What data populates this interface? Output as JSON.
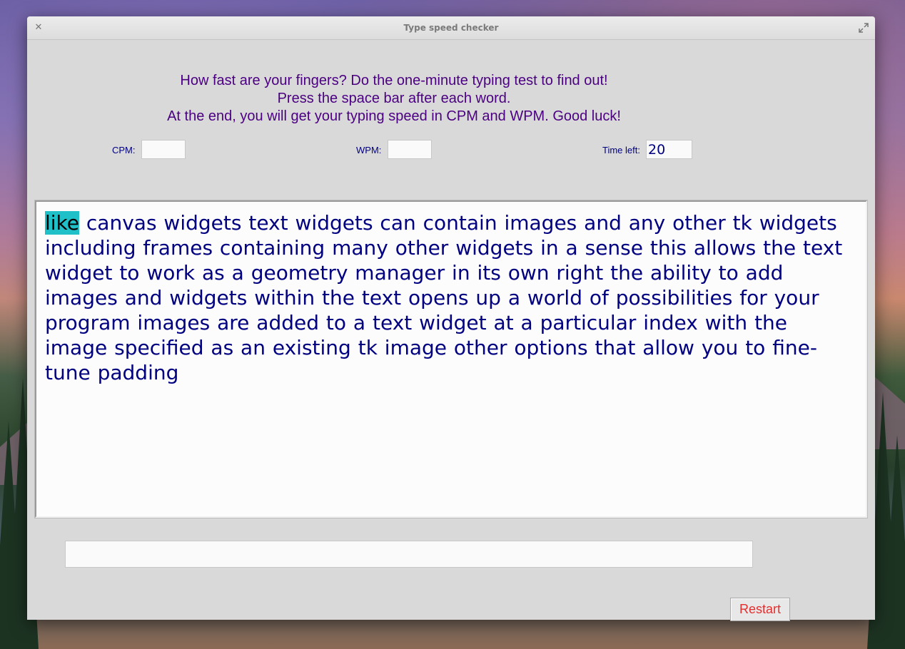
{
  "window": {
    "title": "Type speed checker",
    "close_icon": "close-icon",
    "maximize_icon": "maximize-icon"
  },
  "instructions": [
    "How fast are your fingers? Do the one-minute typing test to find out!",
    "Press the space bar after each word.",
    "At the end, you will get your typing speed in CPM and WPM. Good luck!"
  ],
  "stats": {
    "cpm_label": "CPM:",
    "cpm_value": "",
    "wpm_label": "WPM:",
    "wpm_value": "",
    "time_label": "Time left:",
    "time_value": "20"
  },
  "passage": {
    "current_word": "like",
    "remaining_text": " canvas widgets text widgets can contain images and any other tk widgets including frames containing many other widgets in a sense this allows the text widget to work as a geometry manager in its own right the ability to add images and widgets within the text opens up a world of possibilities for your program images are added to a text widget at a particular index with the image specified as an existing tk image other options that allow you to fine-tune padding"
  },
  "entry": {
    "value": ""
  },
  "buttons": {
    "restart_label": "Restart"
  },
  "colors": {
    "text_primary": "#000080",
    "instructions": "#4b0082",
    "highlight": "#20c0c8",
    "restart_text": "#e03030",
    "window_bg": "#d9d9d9"
  }
}
